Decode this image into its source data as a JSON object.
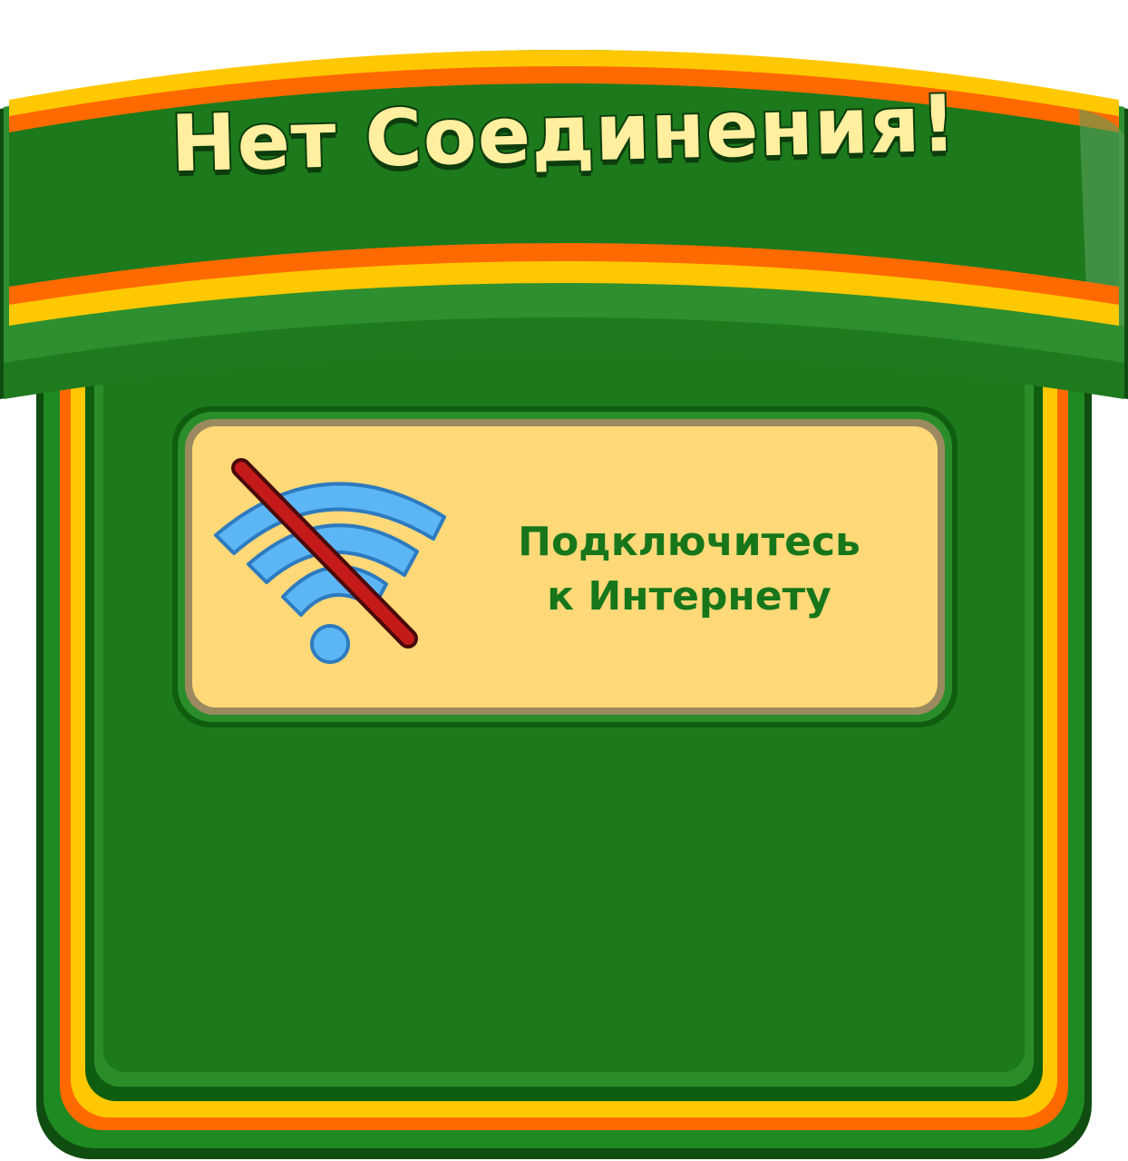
{
  "dialog": {
    "title": "Нет Соединения!",
    "message_line_1": "Подключитесь",
    "message_line_2": "к Интернету",
    "icon": "wifi-off-icon"
  },
  "colors": {
    "panel_green": "#1a7d1a",
    "dark_green": "#0f4e10",
    "stripe_orange": "#ff6a00",
    "stripe_yellow": "#ffc800",
    "card_fill": "#ffd978",
    "message_green": "#17761a",
    "wifi_blue": "#5cb6f5",
    "slash_red": "#c41a1a"
  }
}
